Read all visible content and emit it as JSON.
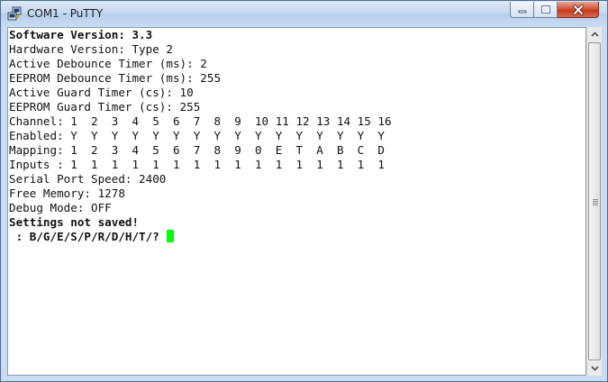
{
  "window": {
    "title": "COM1 - PuTTY",
    "icon": "putty-icon",
    "controls": [
      "minimize-icon",
      "maximize-icon",
      "close-icon"
    ]
  },
  "terminal": {
    "lines": [
      {
        "text": "Software Version: 3.3",
        "bold": true
      },
      {
        "text": "Hardware Version: Type 2",
        "bold": false
      },
      {
        "text": "Active Debounce Timer (ms): 2",
        "bold": false
      },
      {
        "text": "EEPROM Debounce Timer (ms): 255",
        "bold": false
      },
      {
        "text": "Active Guard Timer (cs): 10",
        "bold": false
      },
      {
        "text": "EEPROM Guard Timer (cs): 255",
        "bold": false
      },
      {
        "text": "Channel: 1  2  3  4  5  6  7  8  9  10 11 12 13 14 15 16",
        "bold": false
      },
      {
        "text": "Enabled: Y  Y  Y  Y  Y  Y  Y  Y  Y  Y  Y  Y  Y  Y  Y  Y",
        "bold": false
      },
      {
        "text": "Mapping: 1  2  3  4  5  6  7  8  9  0  E  T  A  B  C  D",
        "bold": false
      },
      {
        "text": "Inputs : 1  1  1  1  1  1  1  1  1  1  1  1  1  1  1  1",
        "bold": false
      },
      {
        "text": "Serial Port Speed: 2400",
        "bold": false
      },
      {
        "text": "Free Memory: 1278",
        "bold": false
      },
      {
        "text": "Debug Mode: OFF",
        "bold": false
      },
      {
        "text": "Settings not saved!",
        "bold": true
      },
      {
        "text": " : B/G/E/S/P/R/D/H/T/? ",
        "bold": true
      }
    ],
    "cursor_color": "#00ff00"
  },
  "colors": {
    "titlebar": "#c6d9f1",
    "close_button": "#c7391c",
    "terminal_bg": "#ffffff",
    "terminal_fg": "#111111"
  }
}
